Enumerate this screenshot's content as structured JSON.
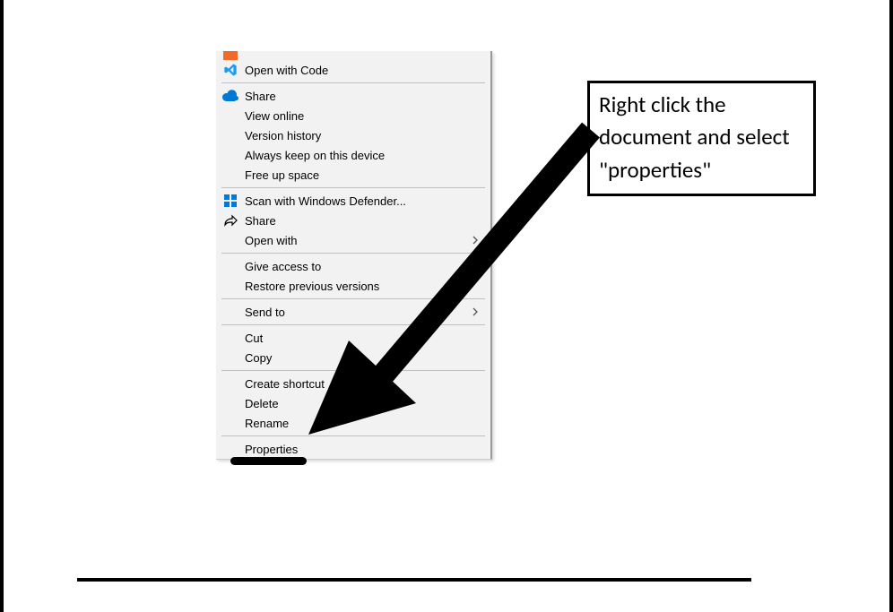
{
  "context_menu": {
    "items": [
      {
        "label": "",
        "icon": "orange-icon",
        "cutoff": true
      },
      {
        "label": "Open with Code",
        "icon": "vscode-icon"
      },
      {
        "sep": true
      },
      {
        "label": "Share",
        "icon": "cloud-icon"
      },
      {
        "label": "View online"
      },
      {
        "label": "Version history"
      },
      {
        "label": "Always keep on this device"
      },
      {
        "label": "Free up space"
      },
      {
        "sep": true
      },
      {
        "label": "Scan with Windows Defender...",
        "icon": "defender-icon"
      },
      {
        "label": "Share",
        "icon": "share-arrow-icon"
      },
      {
        "label": "Open with",
        "submenu": true
      },
      {
        "sep": true
      },
      {
        "label": "Give access to",
        "submenu": true
      },
      {
        "label": "Restore previous versions"
      },
      {
        "sep": true
      },
      {
        "label": "Send to",
        "submenu": true
      },
      {
        "sep": true
      },
      {
        "label": "Cut"
      },
      {
        "label": "Copy"
      },
      {
        "sep": true
      },
      {
        "label": "Create shortcut"
      },
      {
        "label": "Delete"
      },
      {
        "label": "Rename"
      },
      {
        "sep": true
      },
      {
        "label": "Properties"
      }
    ]
  },
  "annotation": {
    "text": "Right click the document and select \"properties\""
  }
}
